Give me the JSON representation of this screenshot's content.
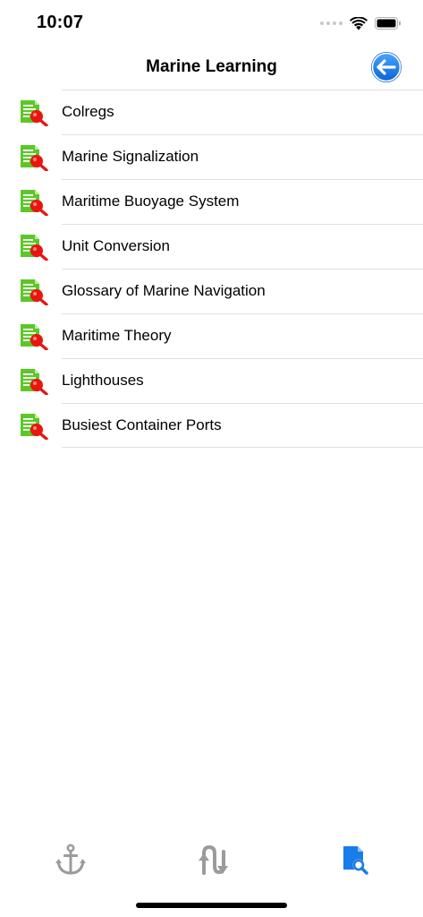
{
  "status_bar": {
    "time": "10:07"
  },
  "nav": {
    "title": "Marine Learning",
    "back_icon": "back-arrow-circle-icon"
  },
  "list_icon": "document-search-icon",
  "items": [
    {
      "label": "Colregs"
    },
    {
      "label": "Marine Signalization"
    },
    {
      "label": "Maritime Buoyage System"
    },
    {
      "label": "Unit Conversion"
    },
    {
      "label": "Glossary of Marine Navigation"
    },
    {
      "label": "Maritime Theory"
    },
    {
      "label": "Lighthouses"
    },
    {
      "label": "Busiest Container Ports"
    }
  ],
  "tabs": [
    {
      "icon": "anchor-icon",
      "active": false
    },
    {
      "icon": "route-arrows-icon",
      "active": false
    },
    {
      "icon": "document-search-icon",
      "active": true
    }
  ],
  "colors": {
    "accent": "#1a7bea",
    "tab_inactive": "#9b9b9b",
    "icon_green": "#5dc72a",
    "icon_red": "#e8160f"
  }
}
